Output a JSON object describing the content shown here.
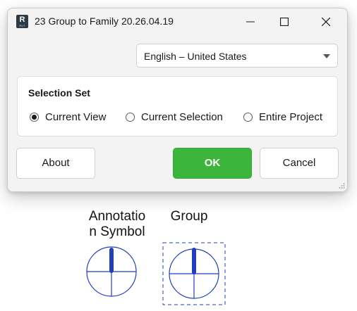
{
  "window": {
    "app_icon_letter": "R",
    "app_icon_sub": "RVT",
    "title": "23 Group to Family 20.26.04.19",
    "controls": {
      "minimize": "minimize-icon",
      "maximize": "maximize-icon",
      "close": "close-icon"
    }
  },
  "language": {
    "selected": "English – United States"
  },
  "selection_set": {
    "title": "Selection Set",
    "options": [
      {
        "label": "Current View",
        "checked": true
      },
      {
        "label": "Current Selection",
        "checked": false
      },
      {
        "label": "Entire Project",
        "checked": false
      }
    ]
  },
  "buttons": {
    "about": "About",
    "ok": "OK",
    "cancel": "Cancel"
  },
  "symbols": {
    "annotation_label": "Annotatio\nn Symbol",
    "group_label": "Group"
  },
  "colors": {
    "ok_green": "#3cb53c",
    "symbol_blue": "#1f3fbf"
  }
}
